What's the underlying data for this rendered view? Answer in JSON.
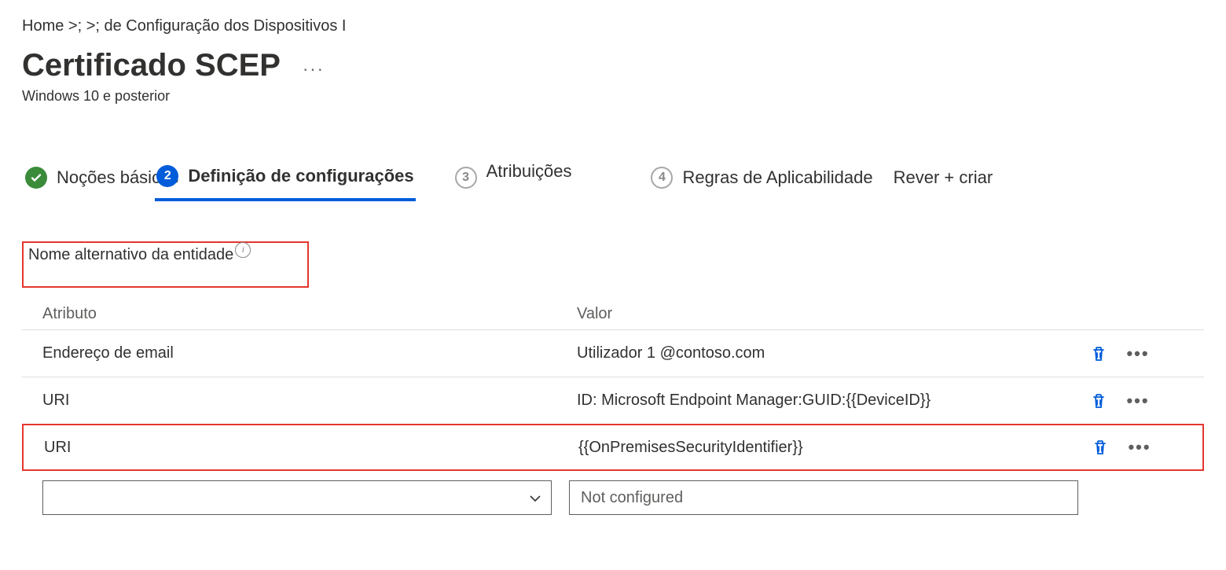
{
  "breadcrumb": "Home >;  >; de Configuração dos Dispositivos I",
  "page_title": "Certificado SCEP",
  "page_subtitle": "Windows 10 e posterior",
  "more_dots": "···",
  "steps": {
    "s1": {
      "label": "Noções básicas"
    },
    "s2": {
      "badge": "2",
      "label": "Definição de configurações"
    },
    "s3": {
      "badge": "3",
      "label": "Atribuições"
    },
    "s4": {
      "badge": "4",
      "label": "Regras de Aplicabilidade"
    },
    "s5": {
      "label": "Rever + criar"
    }
  },
  "section_label": "Nome alternativo da entidade",
  "info_glyph": "i",
  "table": {
    "head_attr": "Atributo",
    "head_val": "Valor",
    "rows": [
      {
        "attr": "Endereço de email",
        "val": "Utilizador 1 @contoso.com",
        "small_val": true
      },
      {
        "attr": "URI",
        "val": "ID: Microsoft Endpoint Manager:GUID:{{DeviceID}}"
      },
      {
        "attr": "URI",
        "val": "{{OnPremisesSecurityIdentifier}}",
        "highlight": true
      }
    ]
  },
  "new_row": {
    "select_placeholder": "",
    "value_placeholder": "Not configured"
  },
  "row_ellipsis": "•••",
  "icons": {
    "trash": "trash",
    "check": "✓"
  }
}
